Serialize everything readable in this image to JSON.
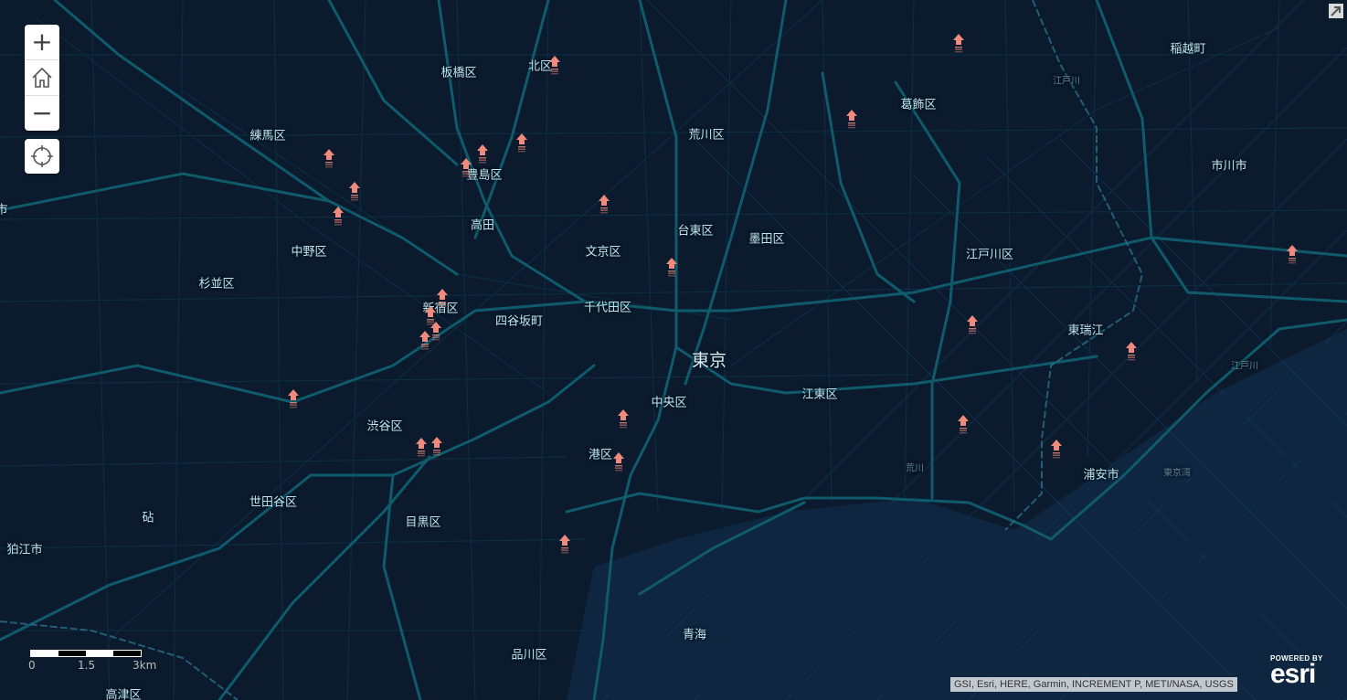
{
  "map": {
    "labels": [
      {
        "text": "板橋区"
      },
      {
        "text": "北区"
      },
      {
        "text": "葛飾区"
      },
      {
        "text": "稲越町"
      },
      {
        "text": "練馬区"
      },
      {
        "text": "荒川区"
      },
      {
        "text": "豊島区"
      },
      {
        "text": "江戸川"
      },
      {
        "text": "市川市"
      },
      {
        "text": "高田"
      },
      {
        "text": "台東区"
      },
      {
        "text": "墨田区"
      },
      {
        "text": "中野区"
      },
      {
        "text": "文京区"
      },
      {
        "text": "江戸川区"
      },
      {
        "text": "杉並区"
      },
      {
        "text": "新宿区"
      },
      {
        "text": "千代田区"
      },
      {
        "text": "四谷坂町"
      },
      {
        "text": "東瑞江"
      },
      {
        "text": "東京"
      },
      {
        "text": "江戸川"
      },
      {
        "text": "江東区"
      },
      {
        "text": "中央区"
      },
      {
        "text": "渋谷区"
      },
      {
        "text": "港区"
      },
      {
        "text": "荒川"
      },
      {
        "text": "東京湾"
      },
      {
        "text": "浦安市"
      },
      {
        "text": "世田谷区"
      },
      {
        "text": "目黒区"
      },
      {
        "text": "砧"
      },
      {
        "text": "狛江市"
      },
      {
        "text": "青海"
      },
      {
        "text": "品川区"
      },
      {
        "text": "高津区"
      },
      {
        "text": "市"
      }
    ],
    "marker_color": "#f08a7c",
    "marker_count": 30
  },
  "controls": {
    "zoom_in": "+",
    "zoom_out": "−",
    "home_icon": "home-icon",
    "locate_icon": "locate-icon"
  },
  "scalebar": {
    "ticks": [
      "0",
      "1.5",
      "3km"
    ]
  },
  "attribution": "GSI, Esri, HERE, Garmin, INCREMENT P, METI/NASA, USGS",
  "esri": {
    "powered_by": "POWERED BY",
    "logo": "esri"
  },
  "colors": {
    "background": "#0b1a2d",
    "road": "#0f5a6b",
    "label": "#bfe6ee",
    "marker": "#f08a7c"
  }
}
